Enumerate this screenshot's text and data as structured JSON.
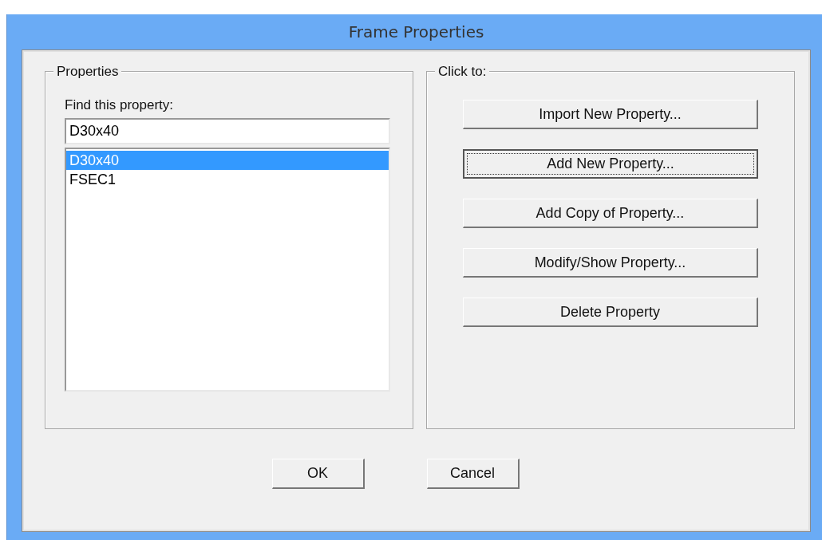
{
  "window": {
    "title": "Frame Properties"
  },
  "properties_group": {
    "title": "Properties",
    "find_label": "Find this property:",
    "find_value": "D30x40",
    "items": [
      {
        "label": "D30x40",
        "selected": true
      },
      {
        "label": "FSEC1",
        "selected": false
      }
    ]
  },
  "actions_group": {
    "title": "Click to:",
    "buttons": [
      {
        "label": "Import New Property...",
        "focused": false
      },
      {
        "label": "Add New Property...",
        "focused": true
      },
      {
        "label": "Add Copy of Property...",
        "focused": false
      },
      {
        "label": "Modify/Show Property...",
        "focused": false
      },
      {
        "label": "Delete Property",
        "focused": false
      }
    ]
  },
  "footer_buttons": [
    "OK",
    "Cancel"
  ]
}
